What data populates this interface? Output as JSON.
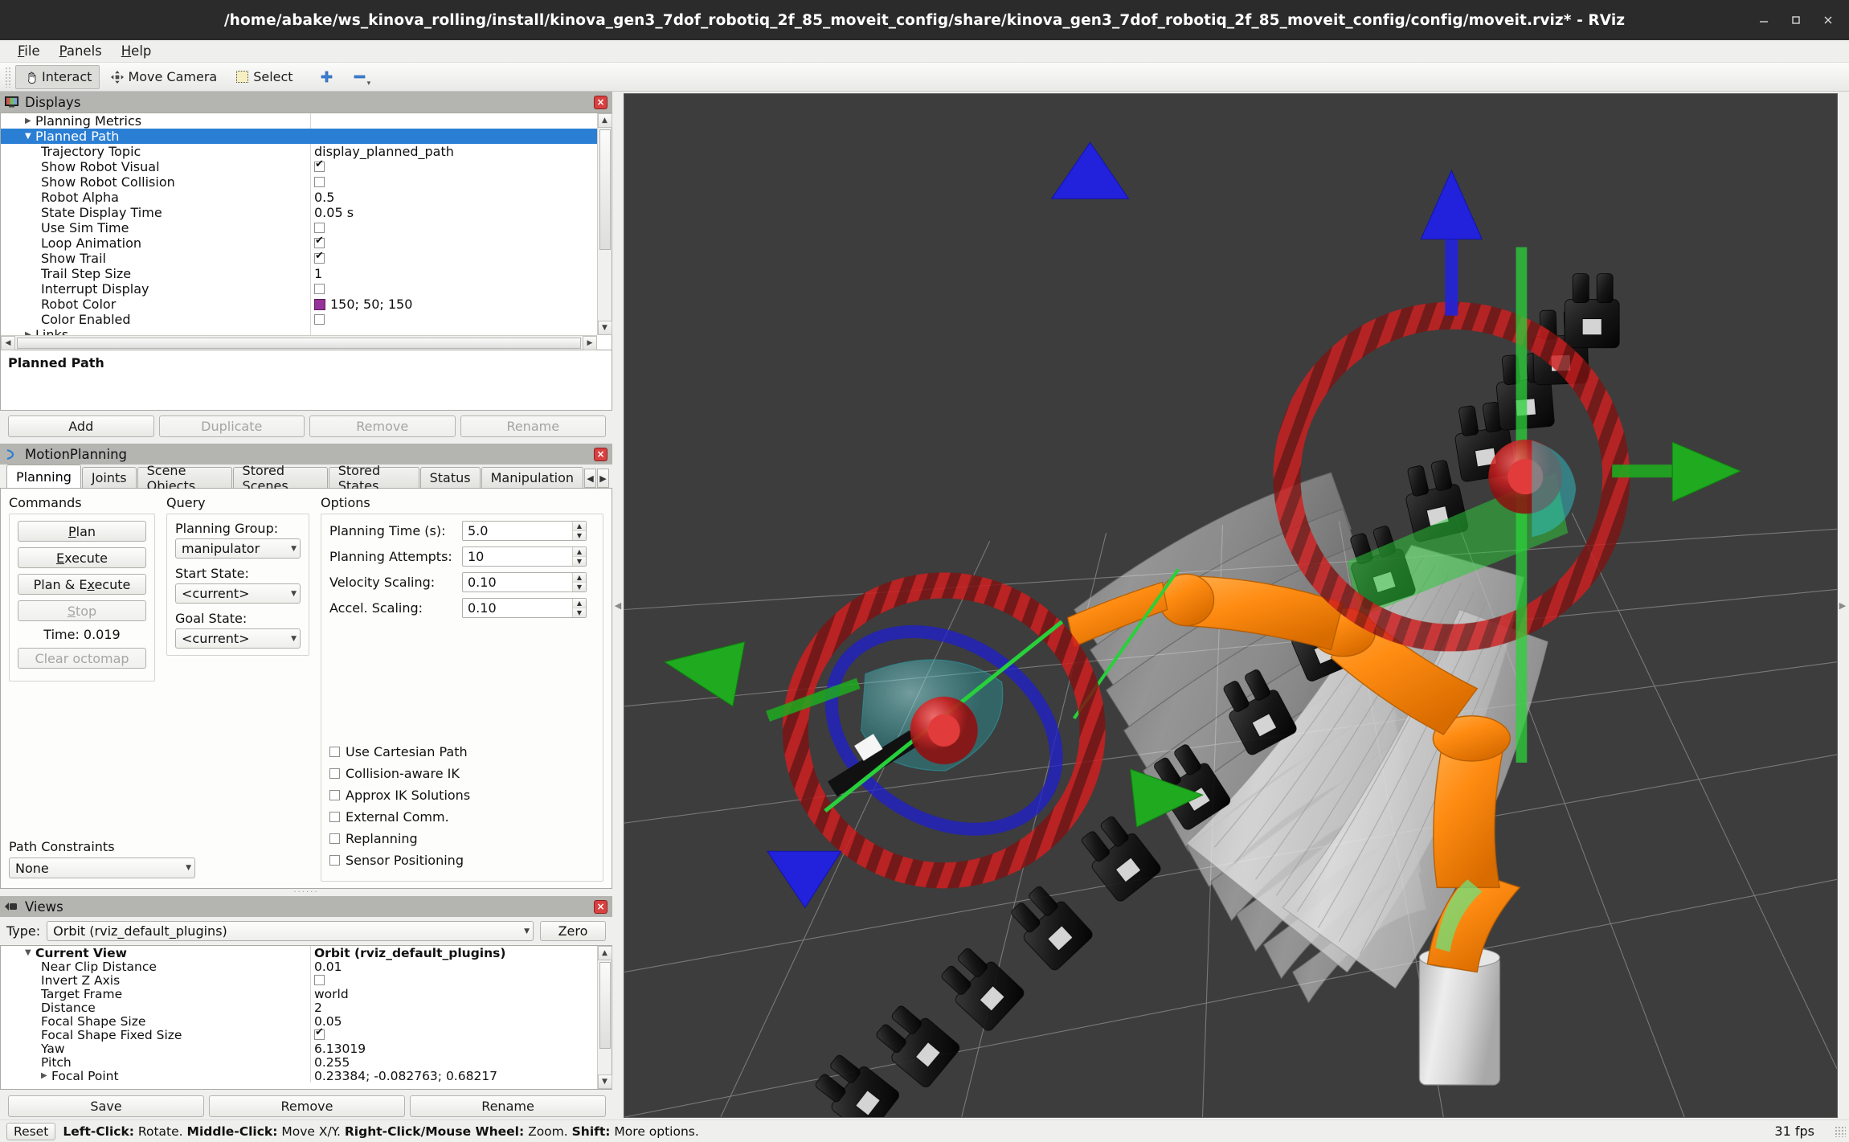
{
  "window": {
    "title": "/home/abake/ws_kinova_rolling/install/kinova_gen3_7dof_robotiq_2f_85_moveit_config/share/kinova_gen3_7dof_robotiq_2f_85_moveit_config/config/moveit.rviz* - RViz",
    "minimize": "minimize-icon",
    "maximize": "maximize-icon",
    "close": "close-icon"
  },
  "menubar": {
    "items": [
      "File",
      "Panels",
      "Help"
    ]
  },
  "toolbar": {
    "interact": "Interact",
    "move_camera": "Move Camera",
    "select": "Select",
    "focus_camera": "focus-camera-icon",
    "measure": "measure-icon"
  },
  "displays": {
    "title": "Displays",
    "rows": [
      {
        "indent": 1,
        "arrow": "right",
        "name": "Planning Metrics",
        "type": "none",
        "value": "",
        "selected": false
      },
      {
        "indent": 1,
        "arrow": "down",
        "name": "Planned Path",
        "type": "none",
        "value": "",
        "selected": true
      },
      {
        "indent": 2,
        "arrow": "",
        "name": "Trajectory Topic",
        "type": "text",
        "value": "display_planned_path",
        "selected": false
      },
      {
        "indent": 2,
        "arrow": "",
        "name": "Show Robot Visual",
        "type": "check",
        "value": true,
        "selected": false
      },
      {
        "indent": 2,
        "arrow": "",
        "name": "Show Robot Collision",
        "type": "check",
        "value": false,
        "selected": false
      },
      {
        "indent": 2,
        "arrow": "",
        "name": "Robot Alpha",
        "type": "text",
        "value": "0.5",
        "selected": false
      },
      {
        "indent": 2,
        "arrow": "",
        "name": "State Display Time",
        "type": "text",
        "value": "0.05 s",
        "selected": false
      },
      {
        "indent": 2,
        "arrow": "",
        "name": "Use Sim Time",
        "type": "check",
        "value": false,
        "selected": false
      },
      {
        "indent": 2,
        "arrow": "",
        "name": "Loop Animation",
        "type": "check",
        "value": true,
        "selected": false
      },
      {
        "indent": 2,
        "arrow": "",
        "name": "Show Trail",
        "type": "check",
        "value": true,
        "selected": false
      },
      {
        "indent": 2,
        "arrow": "",
        "name": "Trail Step Size",
        "type": "text",
        "value": "1",
        "selected": false
      },
      {
        "indent": 2,
        "arrow": "",
        "name": "Interrupt Display",
        "type": "check",
        "value": false,
        "selected": false
      },
      {
        "indent": 2,
        "arrow": "",
        "name": "Robot Color",
        "type": "color",
        "value": "150; 50; 150",
        "color": "#96329a",
        "selected": false
      },
      {
        "indent": 2,
        "arrow": "",
        "name": "Color Enabled",
        "type": "check",
        "value": false,
        "selected": false
      },
      {
        "indent": 1,
        "arrow": "right",
        "name": "Links",
        "type": "none",
        "value": "",
        "selected": false
      }
    ],
    "description": "Planned Path",
    "buttons": {
      "add": "Add",
      "duplicate": "Duplicate",
      "remove": "Remove",
      "rename": "Rename"
    }
  },
  "motion_planning": {
    "title": "MotionPlanning",
    "tabs": [
      "Planning",
      "Joints",
      "Scene Objects",
      "Stored Scenes",
      "Stored States",
      "Status",
      "Manipulation"
    ],
    "active_tab": "Planning",
    "commands": {
      "label": "Commands",
      "plan": "Plan",
      "execute": "Execute",
      "plan_execute": "Plan & Execute",
      "stop": "Stop",
      "time": "Time: 0.019",
      "clear_octomap": "Clear octomap"
    },
    "query": {
      "label": "Query",
      "planning_group_label": "Planning Group:",
      "planning_group_value": "manipulator",
      "start_state_label": "Start State:",
      "start_state_value": "<current>",
      "goal_state_label": "Goal State:",
      "goal_state_value": "<current>"
    },
    "options": {
      "label": "Options",
      "fields": [
        {
          "label": "Planning Time (s):",
          "value": "5.0"
        },
        {
          "label": "Planning Attempts:",
          "value": "10"
        },
        {
          "label": "Velocity Scaling:",
          "value": "0.10"
        },
        {
          "label": "Accel. Scaling:",
          "value": "0.10"
        }
      ],
      "checkboxes": [
        {
          "label": "Use Cartesian Path",
          "checked": false
        },
        {
          "label": "Collision-aware IK",
          "checked": false
        },
        {
          "label": "Approx IK Solutions",
          "checked": false
        },
        {
          "label": "External Comm.",
          "checked": false
        },
        {
          "label": "Replanning",
          "checked": false
        },
        {
          "label": "Sensor Positioning",
          "checked": false
        }
      ]
    },
    "path_constraints": {
      "label": "Path Constraints",
      "value": "None"
    }
  },
  "views": {
    "title": "Views",
    "type_label": "Type:",
    "type_value": "Orbit (rviz_default_plugins)",
    "zero_button": "Zero",
    "rows": [
      {
        "indent": 0,
        "arrow": "down",
        "name": "Current View",
        "type": "text",
        "value": "Orbit (rviz_default_plugins)",
        "bold": true
      },
      {
        "indent": 1,
        "arrow": "",
        "name": "Near Clip Distance",
        "type": "text",
        "value": "0.01",
        "bold": false
      },
      {
        "indent": 1,
        "arrow": "",
        "name": "Invert Z Axis",
        "type": "check",
        "value": false,
        "bold": false
      },
      {
        "indent": 1,
        "arrow": "",
        "name": "Target Frame",
        "type": "text",
        "value": "world",
        "bold": false
      },
      {
        "indent": 1,
        "arrow": "",
        "name": "Distance",
        "type": "text",
        "value": "2",
        "bold": false
      },
      {
        "indent": 1,
        "arrow": "",
        "name": "Focal Shape Size",
        "type": "text",
        "value": "0.05",
        "bold": false
      },
      {
        "indent": 1,
        "arrow": "",
        "name": "Focal Shape Fixed Size",
        "type": "check",
        "value": true,
        "bold": false
      },
      {
        "indent": 1,
        "arrow": "",
        "name": "Yaw",
        "type": "text",
        "value": "6.13019",
        "bold": false
      },
      {
        "indent": 1,
        "arrow": "",
        "name": "Pitch",
        "type": "text",
        "value": "0.255",
        "bold": false
      },
      {
        "indent": 1,
        "arrow": "right",
        "name": "Focal Point",
        "type": "text",
        "value": "0.23384; -0.082763; 0.68217",
        "bold": false
      }
    ],
    "buttons": {
      "save": "Save",
      "remove": "Remove",
      "rename": "Rename"
    }
  },
  "statusbar": {
    "reset": "Reset",
    "hint_parts": [
      {
        "text": "Left-Click:",
        "bold": true
      },
      {
        "text": " Rotate. ",
        "bold": false
      },
      {
        "text": "Middle-Click:",
        "bold": true
      },
      {
        "text": " Move X/Y. ",
        "bold": false
      },
      {
        "text": "Right-Click/Mouse Wheel:",
        "bold": true
      },
      {
        "text": " Zoom. ",
        "bold": false
      },
      {
        "text": "Shift:",
        "bold": true
      },
      {
        "text": " More options.",
        "bold": false
      }
    ],
    "fps": "31 fps"
  },
  "viewport": {
    "name": "rviz-3d-render-view",
    "background": "#3d3d3d",
    "grid_color": "#9a9a9a",
    "robot_color": "#d9d9d9",
    "trajectory_color": "#ff8c1a",
    "gripper_color": "#1a1a1a",
    "marker_ring_color": "#c81e1e",
    "axis_x_color": "#18a018",
    "axis_y_color": "#1b1bdc",
    "axis_z_color": "#1b1bdc",
    "center_sphere_color": "#cc2222"
  }
}
